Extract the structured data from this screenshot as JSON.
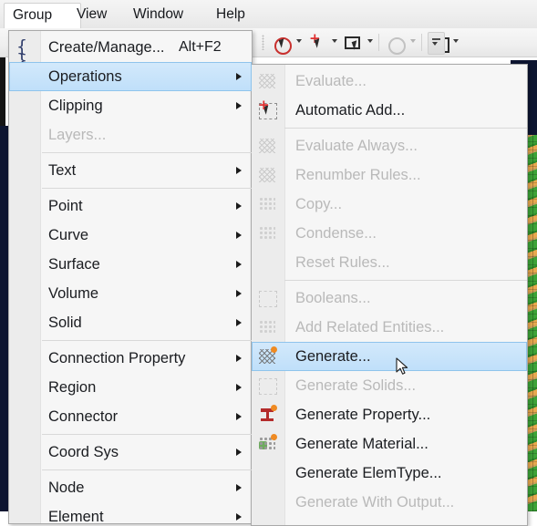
{
  "app": {
    "menubar": [
      {
        "label": "Group",
        "active": true
      },
      {
        "label": "View",
        "active": false
      },
      {
        "label": "Window",
        "active": false
      },
      {
        "label": "Help",
        "active": false
      }
    ]
  },
  "toolbar": {
    "buttons": [
      {
        "name": "no-pick-tool",
        "icon": "red-circle-cursor-icon",
        "enabled": true,
        "has_dropdown": true
      },
      {
        "name": "add-pick-tool",
        "icon": "plus-cursor-icon",
        "enabled": true,
        "has_dropdown": true
      },
      {
        "name": "rectangle-pick-tool",
        "icon": "rect-cursor-icon",
        "enabled": true,
        "has_dropdown": true
      },
      {
        "name": "circle-pick-tool",
        "icon": "gray-circle-icon",
        "enabled": false,
        "has_dropdown": true
      },
      {
        "name": "box-pick-tool",
        "icon": "square-icon",
        "enabled": true,
        "has_dropdown": true
      }
    ],
    "overflow_label": "toolbar-overflow"
  },
  "group_menu": {
    "name": "Group",
    "items": [
      {
        "label": "Create/Manage...",
        "accel": "Alt+F2",
        "icon": "brace-icon",
        "enabled": true,
        "submenu": false,
        "selected": false
      },
      {
        "label": "Operations",
        "accel": "",
        "icon": "",
        "enabled": true,
        "submenu": true,
        "selected": true
      },
      {
        "label": "Clipping",
        "accel": "",
        "icon": "",
        "enabled": true,
        "submenu": true,
        "selected": false
      },
      {
        "label": "Layers...",
        "accel": "",
        "icon": "",
        "enabled": false,
        "submenu": false,
        "selected": false
      },
      {
        "separator": true
      },
      {
        "label": "Text",
        "accel": "",
        "icon": "",
        "enabled": true,
        "submenu": true,
        "selected": false
      },
      {
        "separator": true
      },
      {
        "label": "Point",
        "accel": "",
        "icon": "",
        "enabled": true,
        "submenu": true,
        "selected": false
      },
      {
        "label": "Curve",
        "accel": "",
        "icon": "",
        "enabled": true,
        "submenu": true,
        "selected": false
      },
      {
        "label": "Surface",
        "accel": "",
        "icon": "",
        "enabled": true,
        "submenu": true,
        "selected": false
      },
      {
        "label": "Volume",
        "accel": "",
        "icon": "",
        "enabled": true,
        "submenu": true,
        "selected": false
      },
      {
        "label": "Solid",
        "accel": "",
        "icon": "",
        "enabled": true,
        "submenu": true,
        "selected": false
      },
      {
        "separator": true
      },
      {
        "label": "Connection Property",
        "accel": "",
        "icon": "",
        "enabled": true,
        "submenu": true,
        "selected": false
      },
      {
        "label": "Region",
        "accel": "",
        "icon": "",
        "enabled": true,
        "submenu": true,
        "selected": false
      },
      {
        "label": "Connector",
        "accel": "",
        "icon": "",
        "enabled": true,
        "submenu": true,
        "selected": false
      },
      {
        "separator": true
      },
      {
        "label": "Coord Sys",
        "accel": "",
        "icon": "",
        "enabled": true,
        "submenu": true,
        "selected": false
      },
      {
        "separator": true
      },
      {
        "label": "Node",
        "accel": "",
        "icon": "",
        "enabled": true,
        "submenu": true,
        "selected": false
      },
      {
        "label": "Element",
        "accel": "",
        "icon": "",
        "enabled": true,
        "submenu": true,
        "selected": false
      }
    ]
  },
  "operations_submenu": {
    "name": "Operations",
    "items": [
      {
        "label": "Evaluate...",
        "icon": "evaluate-icon",
        "enabled": false,
        "selected": false
      },
      {
        "label": "Automatic Add...",
        "icon": "automatic-add-icon",
        "enabled": true,
        "selected": false
      },
      {
        "separator": true
      },
      {
        "label": "Evaluate Always...",
        "icon": "evaluate-always-icon",
        "enabled": false,
        "selected": false
      },
      {
        "label": "Renumber Rules...",
        "icon": "renumber-rules-icon",
        "enabled": false,
        "selected": false
      },
      {
        "label": "Copy...",
        "icon": "copy-icon",
        "enabled": false,
        "selected": false
      },
      {
        "label": "Condense...",
        "icon": "condense-icon",
        "enabled": false,
        "selected": false
      },
      {
        "label": "Reset Rules...",
        "icon": "",
        "enabled": false,
        "selected": false
      },
      {
        "separator": true
      },
      {
        "label": "Booleans...",
        "icon": "booleans-icon",
        "enabled": false,
        "selected": false
      },
      {
        "label": "Add Related Entities...",
        "icon": "add-related-entities-icon",
        "enabled": false,
        "selected": false
      },
      {
        "label": "Generate...",
        "icon": "generate-icon",
        "enabled": true,
        "selected": true
      },
      {
        "label": "Generate Solids...",
        "icon": "generate-solids-icon",
        "enabled": false,
        "selected": false
      },
      {
        "label": "Generate Property...",
        "icon": "generate-property-icon",
        "enabled": true,
        "selected": false
      },
      {
        "label": "Generate Material...",
        "icon": "generate-material-icon",
        "enabled": true,
        "selected": false
      },
      {
        "label": "Generate ElemType...",
        "icon": "",
        "enabled": true,
        "selected": false
      },
      {
        "label": "Generate With Output...",
        "icon": "",
        "enabled": false,
        "selected": false
      }
    ]
  },
  "colors": {
    "menu_background": "#f6f6f6",
    "menu_gutter": "#ececec",
    "highlight": "#bfdffa",
    "highlight_border": "#8fc4ec",
    "disabled_text": "#b9b9b9",
    "text": "#1a1c20",
    "viewport_dark": "#0d1530",
    "model_orange": "#e8a84e",
    "model_green": "#3da337"
  }
}
